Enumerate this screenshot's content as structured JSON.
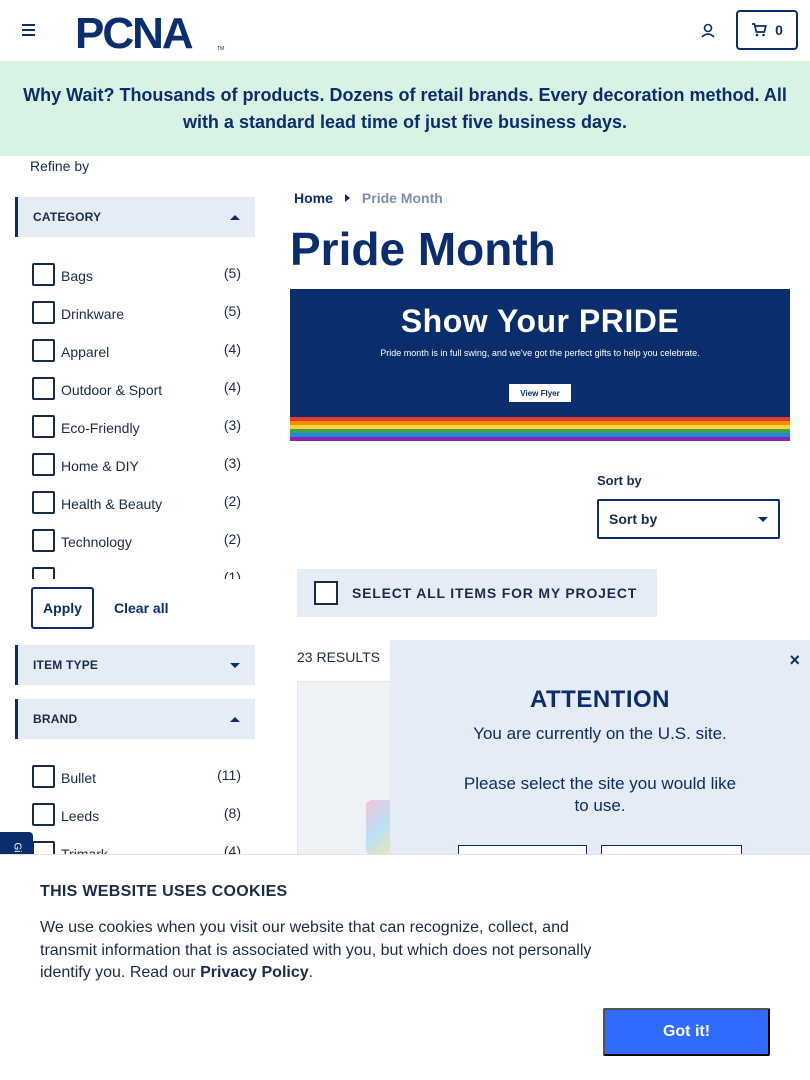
{
  "header": {
    "logo_text": "PCNA",
    "cart_count": "0"
  },
  "banner": {
    "text": "Why Wait? Thousands of products. Dozens of retail brands. Every decoration method. All with a standard lead time of just five business days."
  },
  "sidebar": {
    "refine_label": "Refine by",
    "category": {
      "label": "CATEGORY",
      "items": [
        {
          "name": "Bags",
          "count": "(5)"
        },
        {
          "name": "Drinkware",
          "count": "(5)"
        },
        {
          "name": "Apparel",
          "count": "(4)"
        },
        {
          "name": "Outdoor & Sport",
          "count": "(4)"
        },
        {
          "name": "Eco-Friendly",
          "count": "(3)"
        },
        {
          "name": "Home & DIY",
          "count": "(3)"
        },
        {
          "name": "Health & Beauty",
          "count": "(2)"
        },
        {
          "name": "Technology",
          "count": "(2)"
        },
        {
          "name": "",
          "count": "(1)"
        }
      ]
    },
    "apply_label": "Apply",
    "clear_label": "Clear all",
    "item_type": {
      "label": "ITEM TYPE"
    },
    "brand": {
      "label": "BRAND",
      "items": [
        {
          "name": "Bullet",
          "count": "(11)"
        },
        {
          "name": "Leeds",
          "count": "(8)"
        },
        {
          "name": "Trimark",
          "count": "(4)"
        }
      ]
    }
  },
  "main": {
    "breadcrumb": {
      "home": "Home",
      "current": "Pride Month"
    },
    "title": "Pride Month",
    "promo": {
      "headline": "Show Your PRIDE",
      "subtext": "Pride month is in full swing, and we've got the perfect gifts to help you celebrate.",
      "button": "View Flyer",
      "rainbow_colors": [
        "#e53935",
        "#fb8c00",
        "#fdd835",
        "#43a047",
        "#1e88e5",
        "#8e24aa"
      ]
    },
    "sort": {
      "label": "Sort by",
      "selected": "Sort by"
    },
    "select_all_label": "SELECT ALL ITEMS FOR MY PROJECT",
    "results_label": "23 RESULTS"
  },
  "attention": {
    "close": "×",
    "title": "ATTENTION",
    "line1": "You are currently on the U.S. site.",
    "line2": "Please select the site you would like to use."
  },
  "side_tab": {
    "label": "Gi"
  },
  "cookie": {
    "title": "THIS WEBSITE USES COOKIES",
    "text": "We use cookies when you visit our website that can recognize, collect, and transmit information that is associated with you, but which does not personally identify you. Read our",
    "policy_link": "Privacy Policy",
    "period": ".",
    "button": "Got it!"
  },
  "colors": {
    "brand_navy": "#0a2d6e",
    "banner_green": "#d8f3e3",
    "facet_bg": "#e6ecf5",
    "cta_blue": "#2f6bff"
  }
}
